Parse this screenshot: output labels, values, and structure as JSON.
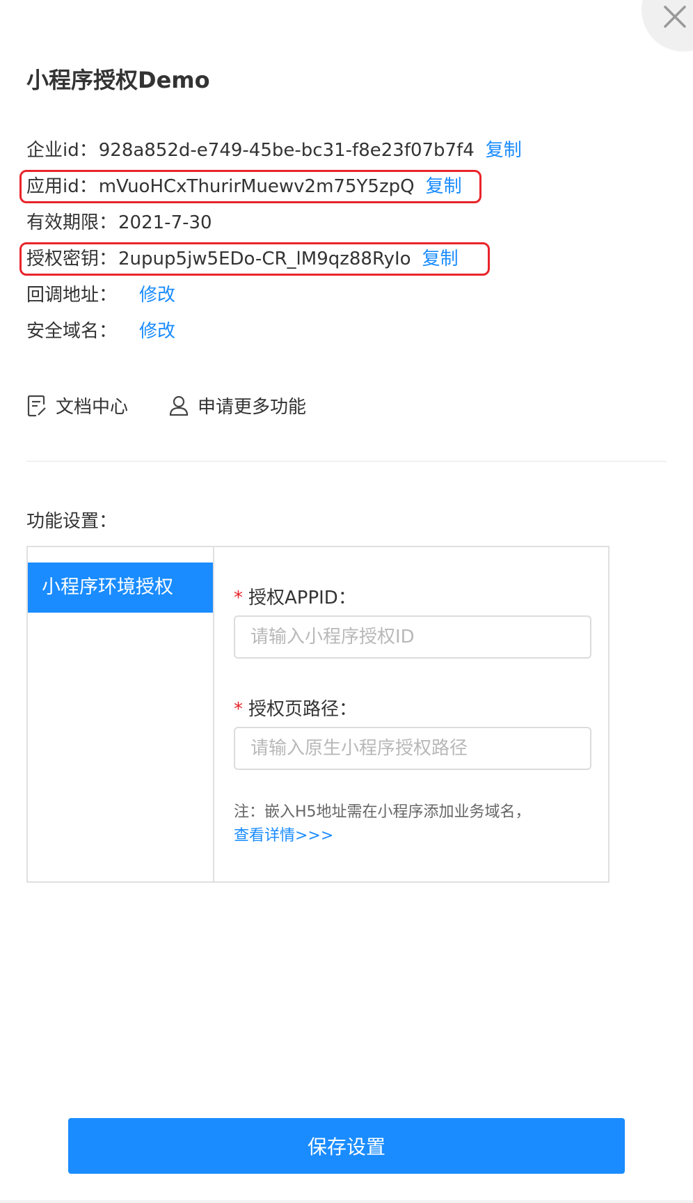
{
  "dialog": {
    "title": "小程序授权Demo",
    "close_icon": "close-icon"
  },
  "info": {
    "enterprise_id": {
      "label": "企业id：",
      "value": "928a852d-e749-45be-bc31-f8e23f07b7f4",
      "action": "复制"
    },
    "app_id": {
      "label": "应用id：",
      "value": "mVuoHCxThurirMuewv2m75Y5zpQ",
      "action": "复制"
    },
    "valid_until": {
      "label": "有效期限：",
      "value": "2021-7-30"
    },
    "auth_key": {
      "label": "授权密钥：",
      "value": "2upup5jw5EDo-CR_lM9qz88RyIo",
      "action": "复制"
    },
    "callback_url": {
      "label": "回调地址：",
      "action": "修改"
    },
    "safe_domain": {
      "label": "安全域名：",
      "action": "修改"
    }
  },
  "tools": {
    "docs": {
      "label": "文档中心",
      "icon": "document-icon"
    },
    "apply": {
      "label": "申请更多功能",
      "icon": "user-icon"
    }
  },
  "settings": {
    "section_label": "功能设置：",
    "menu": {
      "active_item": "小程序环境授权"
    },
    "form": {
      "required_mark": "*",
      "appid_label": "授权APPID：",
      "appid_placeholder": "请输入小程序授权ID",
      "path_label": "授权页路径：",
      "path_placeholder": "请输入原生小程序授权路径",
      "note_text": "注：嵌入H5地址需在小程序添加业务域名，",
      "note_link": "查看详情>>>"
    }
  },
  "footer": {
    "save_label": "保存设置"
  },
  "colors": {
    "accent": "#1a8cff",
    "highlight": "#e8242a",
    "required": "#e8242a"
  }
}
